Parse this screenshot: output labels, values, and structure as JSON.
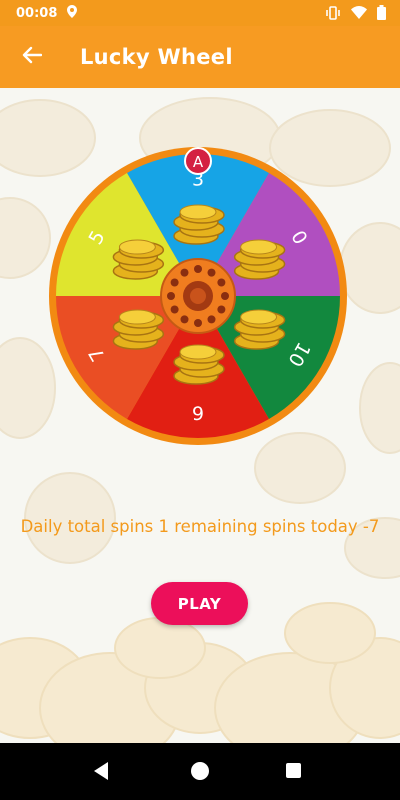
{
  "status_bar": {
    "time": "00:08"
  },
  "app_bar": {
    "title": "Lucky Wheel"
  },
  "wheel": {
    "segments": [
      {
        "label": "3",
        "color": "#16a4e6"
      },
      {
        "label": "0",
        "color": "#b04fc0"
      },
      {
        "label": "10",
        "color": "#12883e"
      },
      {
        "label": "6",
        "color": "#e11f13"
      },
      {
        "label": "7",
        "color": "#ea4e24"
      },
      {
        "label": "5",
        "color": "#dfe52e"
      }
    ],
    "pointer_label": "A"
  },
  "message": "Daily total spins 1 remaining spins today -7",
  "play_button": {
    "label": "PLAY"
  },
  "colors": {
    "accent": "#f79b22",
    "play": "#ec0f5a",
    "text_accent": "#f39a1c"
  }
}
